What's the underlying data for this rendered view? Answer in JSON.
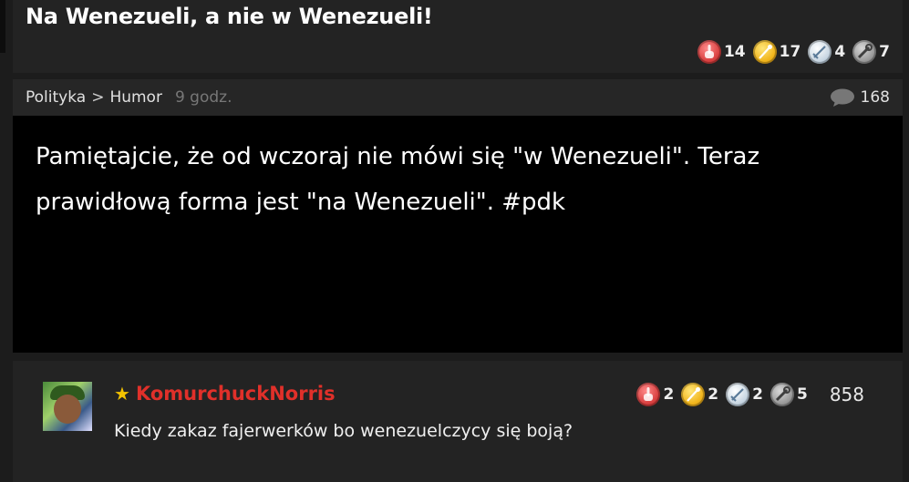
{
  "post": {
    "title": "Na Wenezueli, a nie w Wenezueli!",
    "badges": [
      {
        "icon": "red-middle-finger-coin-icon",
        "count": "14"
      },
      {
        "icon": "gold-wand-coin-icon",
        "count": "17"
      },
      {
        "icon": "silver-sword-coin-icon",
        "count": "4"
      },
      {
        "icon": "gray-wrench-coin-icon",
        "count": "7"
      }
    ],
    "category": "Polityka",
    "separator": ">",
    "subcategory": "Humor",
    "time": "9 godz.",
    "comment_count": "168",
    "body": "Pamiętajcie, że od wczoraj nie mówi się \"w Wenezueli\". Teraz prawidłową forma jest \"na Wenezueli\". #pdk"
  },
  "comment": {
    "username": "KomurchuckNorris",
    "text": "Kiedy zakaz fajerwerków bo wenezuelczycy się boją?",
    "badges": [
      {
        "icon": "red-middle-finger-coin-icon",
        "count": "2"
      },
      {
        "icon": "gold-wand-coin-icon",
        "count": "2"
      },
      {
        "icon": "silver-sword-coin-icon",
        "count": "2"
      },
      {
        "icon": "gray-wrench-coin-icon",
        "count": "5"
      }
    ],
    "score": "858"
  },
  "colors": {
    "username": "#e0302a",
    "star": "#f2c200",
    "background": "#1c1c1c",
    "post_body_bg": "#000000"
  }
}
